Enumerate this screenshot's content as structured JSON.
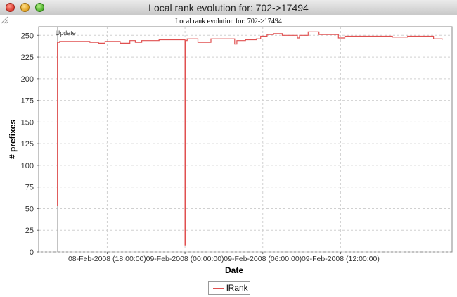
{
  "window": {
    "title": "Local rank evolution for: 702->17494"
  },
  "chart_data": {
    "type": "line",
    "title": "Local rank evolution for: 702->17494",
    "xlabel": "Date",
    "ylabel": "# prefixes",
    "ylim": [
      0,
      260
    ],
    "yticks": [
      0,
      25,
      50,
      75,
      100,
      125,
      150,
      175,
      200,
      225,
      250
    ],
    "xlim": [
      "08-Feb-2008 (12:43:00)",
      "09-Feb-2008 (20:36:00)"
    ],
    "xticks": [
      {
        "label": "08-Feb-2008 (18:00:00)",
        "value": "08-Feb-2008 (18:00:00)"
      },
      {
        "label": "09-Feb-2008 (00:00:00)",
        "value": "09-Feb-2008 (00:00:00)"
      },
      {
        "label": "09-Feb-2008 (06:00:00)",
        "value": "09-Feb-2008 (06:00:00)"
      },
      {
        "label": "09-Feb-2008 (12:00:00)",
        "value": "09-Feb-2008 (12:00:00)"
      }
    ],
    "grid": true,
    "legend": "bottom-center",
    "annotations": [
      {
        "text": "Update",
        "x": "08-Feb-2008 (14:10:00)"
      }
    ],
    "series": [
      {
        "name": "lRank",
        "color": "#e05050",
        "step": true,
        "points": [
          [
            "08-Feb-2008 (14:10:00)",
            53
          ],
          [
            "08-Feb-2008 (14:10:00)",
            242
          ],
          [
            "08-Feb-2008 (14:20:00)",
            243
          ],
          [
            "08-Feb-2008 (16:40:00)",
            242
          ],
          [
            "08-Feb-2008 (17:20:00)",
            241
          ],
          [
            "08-Feb-2008 (17:50:00)",
            243
          ],
          [
            "08-Feb-2008 (19:00:00)",
            241
          ],
          [
            "08-Feb-2008 (19:45:00)",
            244
          ],
          [
            "08-Feb-2008 (20:10:00)",
            242
          ],
          [
            "08-Feb-2008 (20:40:00)",
            244
          ],
          [
            "08-Feb-2008 (22:00:00)",
            245
          ],
          [
            "09-Feb-2008 (00:00:00)",
            245
          ],
          [
            "09-Feb-2008 (00:00:00)",
            8
          ],
          [
            "09-Feb-2008 (00:01:00)",
            125
          ],
          [
            "09-Feb-2008 (00:02:00)",
            244
          ],
          [
            "09-Feb-2008 (00:10:00)",
            246
          ],
          [
            "09-Feb-2008 (01:00:00)",
            242
          ],
          [
            "09-Feb-2008 (02:00:00)",
            246
          ],
          [
            "09-Feb-2008 (03:50:00)",
            240
          ],
          [
            "09-Feb-2008 (04:00:00)",
            244
          ],
          [
            "09-Feb-2008 (04:40:00)",
            245
          ],
          [
            "09-Feb-2008 (05:30:00)",
            246
          ],
          [
            "09-Feb-2008 (05:50:00)",
            249
          ],
          [
            "09-Feb-2008 (06:20:00)",
            251
          ],
          [
            "09-Feb-2008 (06:50:00)",
            252
          ],
          [
            "09-Feb-2008 (07:30:00)",
            250
          ],
          [
            "09-Feb-2008 (08:40:00)",
            247
          ],
          [
            "09-Feb-2008 (08:50:00)",
            250
          ],
          [
            "09-Feb-2008 (09:30:00)",
            254
          ],
          [
            "09-Feb-2008 (10:20:00)",
            251
          ],
          [
            "09-Feb-2008 (11:50:00)",
            247
          ],
          [
            "09-Feb-2008 (12:20:00)",
            249
          ],
          [
            "09-Feb-2008 (14:00:00)",
            249
          ],
          [
            "09-Feb-2008 (16:00:00)",
            248
          ],
          [
            "09-Feb-2008 (17:10:00)",
            249
          ],
          [
            "09-Feb-2008 (19:10:00)",
            246
          ],
          [
            "09-Feb-2008 (19:50:00)",
            245
          ]
        ]
      }
    ]
  }
}
